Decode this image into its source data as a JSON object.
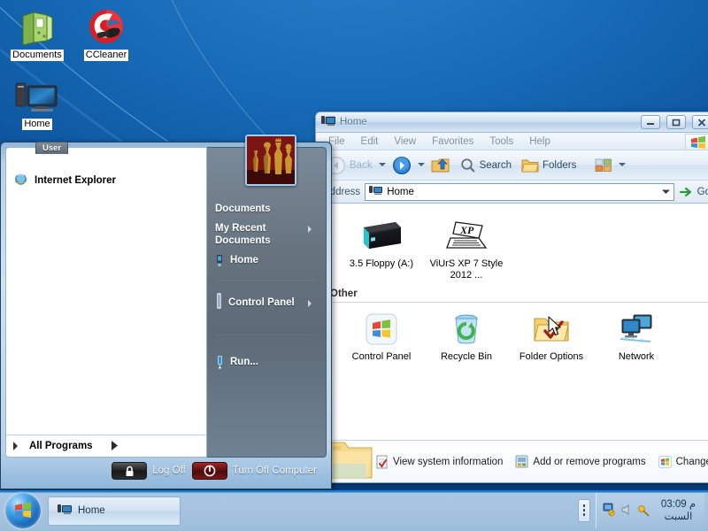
{
  "desktop": {
    "icons": [
      {
        "label": "Documents",
        "icon": "documents-folder-icon"
      },
      {
        "label": "CCleaner",
        "icon": "ccleaner-icon"
      },
      {
        "label": "Home",
        "icon": "my-computer-icon"
      }
    ]
  },
  "start_menu": {
    "user_name": "User",
    "user_picture": "chess-pieces-picture",
    "left_items": [
      {
        "label": "Internet Explorer",
        "icon": "internet-explorer-icon"
      }
    ],
    "all_programs_label": "All Programs",
    "right_items": [
      {
        "label": "Documents",
        "icon": "",
        "has_submenu": false
      },
      {
        "label": "My Recent Documents",
        "icon": "",
        "has_submenu": true
      },
      {
        "label": "Home",
        "icon": "my-computer-icon",
        "has_submenu": false
      },
      {
        "label": "Control Panel",
        "icon": "control-panel-icon",
        "has_submenu": true
      },
      {
        "label": "Run...",
        "icon": "run-icon",
        "has_submenu": false
      }
    ],
    "log_off_label": "Log Off",
    "turn_off_label": "Turn Off Computer"
  },
  "explorer": {
    "title": "Home",
    "title_icon": "my-computer-icon",
    "window_buttons": {
      "minimize": "–",
      "restore": "❐",
      "close": "✕"
    },
    "menu": [
      "File",
      "Edit",
      "View",
      "Favorites",
      "Tools",
      "Help"
    ],
    "toolbar": {
      "back": "Back",
      "forward": "",
      "up": "",
      "search": "Search",
      "folders": "Folders",
      "views": ""
    },
    "address": {
      "label": "Address",
      "value": "Home",
      "go_label": "Go"
    },
    "groups": [
      {
        "header": "",
        "items": [
          {
            "label": "3.5 Floppy (A:)",
            "icon": "floppy-drive-icon"
          },
          {
            "label": "ViUrS XP 7 Style 2012 ...",
            "icon": "shortcut-xp-icon"
          }
        ]
      },
      {
        "header": "Other",
        "items": [
          {
            "label": "Control Panel",
            "icon": "control-panel-icon"
          },
          {
            "label": "Recycle Bin",
            "icon": "recycle-bin-icon"
          },
          {
            "label": "Folder Options",
            "icon": "folder-options-icon"
          },
          {
            "label": "Network",
            "icon": "network-icon"
          }
        ]
      }
    ],
    "status_links": [
      {
        "label": "View system information",
        "icon": "system-info-icon"
      },
      {
        "label": "Add or remove programs",
        "icon": "add-remove-programs-icon"
      },
      {
        "label": "Change a s",
        "icon": "change-setting-icon"
      }
    ]
  },
  "taskbar": {
    "start_button": "start-orb",
    "windows": [
      {
        "label": "Home",
        "icon": "my-computer-icon"
      }
    ],
    "tray_icons": [
      "network-tray-icon",
      "volume-tray-icon",
      "tray-item-icon"
    ],
    "clock_time": "03:09 م",
    "clock_day": "السبت"
  },
  "colors": {
    "desktop_top": "#1d7ac7",
    "desktop_bottom": "#0a3f80",
    "taskbar": "#a6c4e1",
    "taskbar_top_border": "#1a7fd4",
    "start_menu_right": "#64727f",
    "window_chrome": "#d6e4f2",
    "accent_blue": "#1a6fc0"
  }
}
